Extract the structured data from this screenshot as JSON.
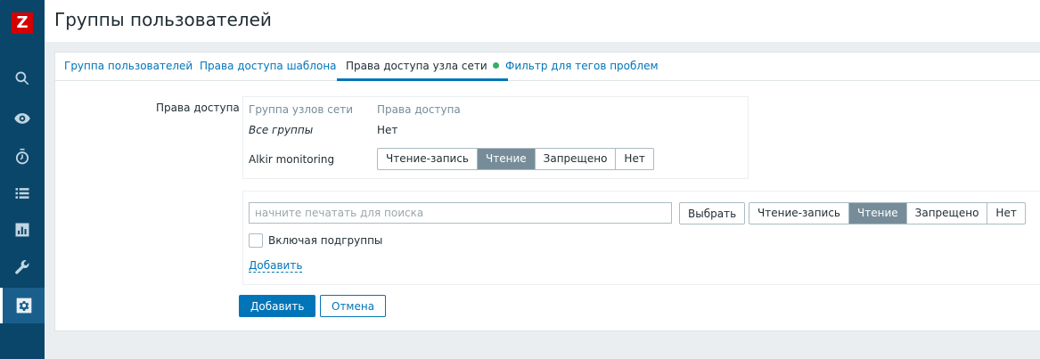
{
  "app": {
    "logo_letter": "Z"
  },
  "sidebar": {
    "items": [
      {
        "icon": "search-icon"
      },
      {
        "icon": "eye-icon"
      },
      {
        "icon": "stopwatch-icon"
      },
      {
        "icon": "list-icon"
      },
      {
        "icon": "chart-icon"
      },
      {
        "icon": "wrench-icon"
      },
      {
        "icon": "gear-icon",
        "active": true
      }
    ]
  },
  "header": {
    "title": "Группы пользователей"
  },
  "tabs": [
    {
      "label": "Группа пользователей"
    },
    {
      "label": "Права доступа шаблона"
    },
    {
      "label": "Права доступа узла сети",
      "active": true
    },
    {
      "label": "Фильтр для тегов проблем"
    }
  ],
  "form": {
    "label": "Права доступа",
    "table": {
      "col_group": "Группа узлов сети",
      "col_rights": "Права доступа",
      "rows": [
        {
          "group": "Все группы",
          "rights": "Нет"
        },
        {
          "group": "Alkir monitoring",
          "selected": "Чтение"
        }
      ]
    },
    "permission_options": [
      "Чтение-запись",
      "Чтение",
      "Запрещено",
      "Нет"
    ],
    "add": {
      "search_placeholder": "начните печатать для поиска",
      "select_label": "Выбрать",
      "selected_permission": "Чтение",
      "include_subgroups_label": "Включая подгруппы",
      "include_subgroups_checked": false,
      "add_link": "Добавить"
    },
    "buttons": {
      "submit": "Добавить",
      "cancel": "Отмена"
    }
  },
  "colors": {
    "accent": "#0275b8",
    "sidebar": "#0a466a",
    "selected_segment": "#768d99",
    "status_dot": "#34af67"
  }
}
